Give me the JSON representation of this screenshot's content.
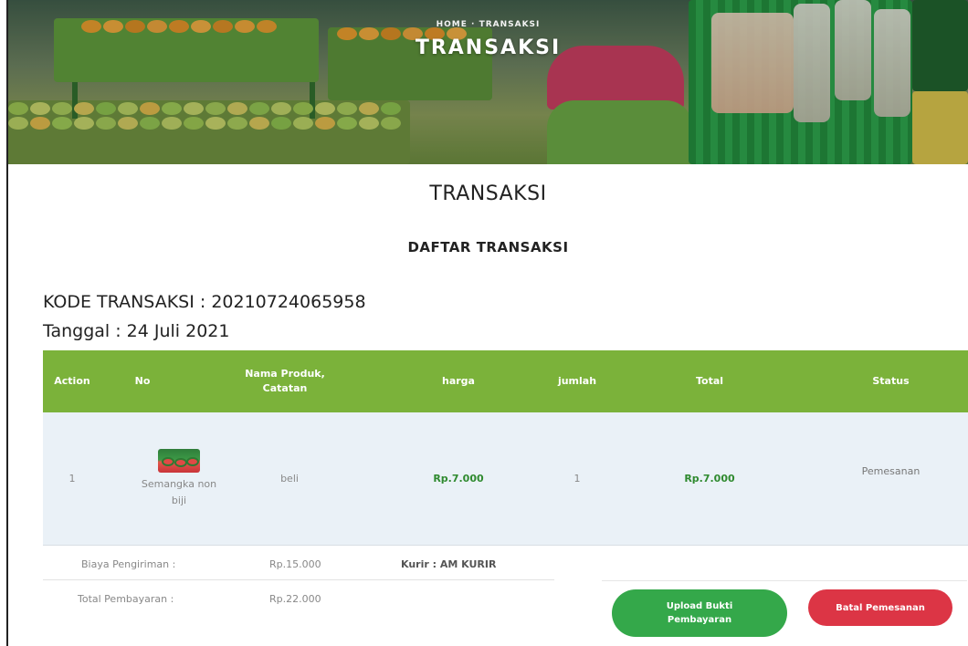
{
  "hero": {
    "breadcrumb": "HOME · TRANSAKSI",
    "title": "TRANSAKSI"
  },
  "page_title": "TRANSAKSI",
  "list_title": "DAFTAR TRANSAKSI",
  "transaction": {
    "kode_label": "KODE TRANSAKSI : 20210724065958",
    "tanggal_label": "Tanggal : 24 Juli 2021"
  },
  "table": {
    "headers": {
      "action": "Action",
      "no": "No",
      "nama_line1": "Nama Produk,",
      "nama_line2": "Catatan",
      "harga": "harga",
      "jumlah": "jumlah",
      "total": "Total",
      "status": "Status"
    },
    "rows": [
      {
        "action": "1",
        "product_line1": "Semangka non",
        "product_line2": "biji",
        "catatan": "beli",
        "harga": "Rp.7.000",
        "jumlah": "1",
        "total": "Rp.7.000",
        "status": "Pemesanan"
      }
    ]
  },
  "summary": {
    "biaya_label": "Biaya Pengiriman :",
    "biaya_value": "Rp.15.000",
    "kurir": "Kurir : AM KURIR",
    "total_label": "Total Pembayaran :",
    "total_value": "Rp.22.000"
  },
  "buttons": {
    "upload_line1": "Upload Bukti",
    "upload_line2": "Pembayaran",
    "batal": "Batal Pemesanan"
  },
  "colors": {
    "table_header": "#7bb23a",
    "upload_button": "#34a84a",
    "batal_button": "#dc3545",
    "price_green": "#2f8a2f"
  }
}
